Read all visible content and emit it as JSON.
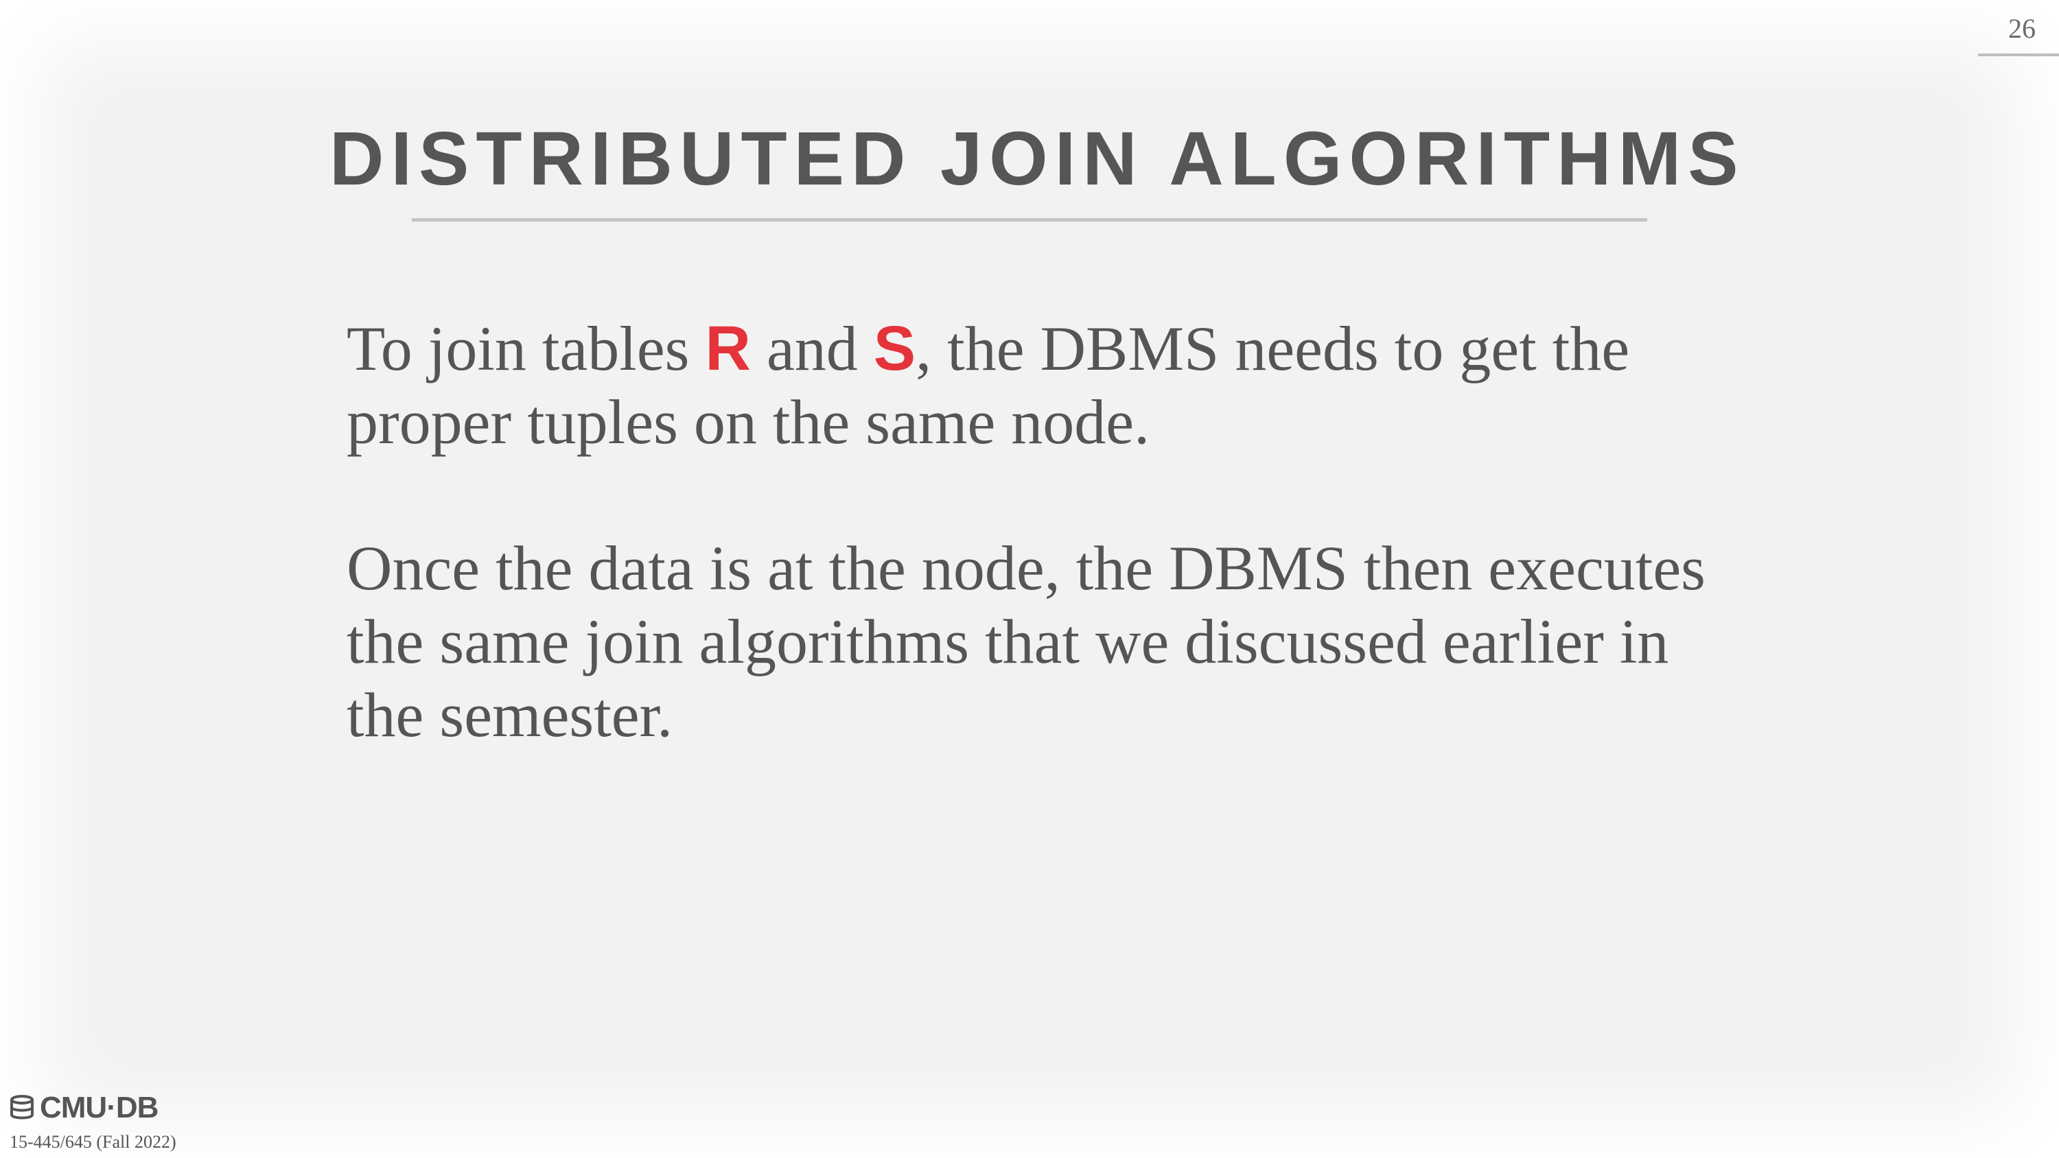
{
  "slide": {
    "page_number": "26",
    "title": "DISTRIBUTED JOIN ALGORITHMS",
    "paragraphs": [
      {
        "part1": "To join tables ",
        "table_r": "R",
        "part2": " and ",
        "table_s": "S",
        "part3": ", the DBMS needs to get the proper tuples on the same node."
      },
      {
        "text": "Once the data is at the node, the DBMS then executes the same join algorithms that we discussed earlier in the semester."
      }
    ],
    "highlight_color": "#e4333a"
  },
  "footer": {
    "logo_text": "CMU·DB",
    "logo_icon": "database-icon",
    "course": "15-445/645 (Fall 2022)"
  }
}
